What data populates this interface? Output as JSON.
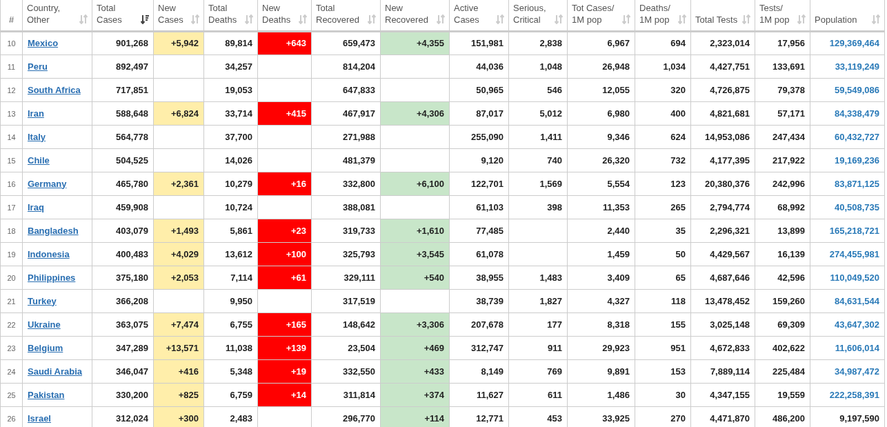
{
  "table": {
    "columns": [
      {
        "label": "#",
        "kind": "index"
      },
      {
        "label": "Country, Other",
        "kind": "country",
        "sorted": false
      },
      {
        "label": "Total Cases",
        "kind": "plain",
        "sorted": true
      },
      {
        "label": "New Cases",
        "kind": "increase",
        "sorted": false
      },
      {
        "label": "Total Deaths",
        "kind": "plain",
        "sorted": false
      },
      {
        "label": "New Deaths",
        "kind": "deaths",
        "sorted": false
      },
      {
        "label": "Total Recovered",
        "kind": "plain",
        "sorted": false
      },
      {
        "label": "New Recovered",
        "kind": "recovered",
        "sorted": false
      },
      {
        "label": "Active Cases",
        "kind": "plain",
        "sorted": false
      },
      {
        "label": "Serious, Critical",
        "kind": "plain",
        "sorted": false
      },
      {
        "label": "Tot Cases/ 1M pop",
        "kind": "plain",
        "sorted": false
      },
      {
        "label": "Deaths/ 1M pop",
        "kind": "plain",
        "sorted": false
      },
      {
        "label": "Total Tests",
        "kind": "plain",
        "sorted": false
      },
      {
        "label": "Tests/ 1M pop",
        "kind": "plain",
        "sorted": false
      },
      {
        "label": "Population",
        "kind": "population",
        "sorted": false
      }
    ],
    "rows": [
      {
        "cells": [
          "10",
          "Mexico",
          "901,268",
          "+5,942",
          "89,814",
          "+643",
          "659,473",
          "+4,355",
          "151,981",
          "2,838",
          "6,967",
          "694",
          "2,323,014",
          "17,956",
          "129,369,464"
        ],
        "population_linked": true
      },
      {
        "cells": [
          "11",
          "Peru",
          "892,497",
          null,
          "34,257",
          null,
          "814,204",
          null,
          "44,036",
          "1,048",
          "26,948",
          "1,034",
          "4,427,751",
          "133,691",
          "33,119,249"
        ],
        "population_linked": true
      },
      {
        "cells": [
          "12",
          "South Africa",
          "717,851",
          null,
          "19,053",
          null,
          "647,833",
          null,
          "50,965",
          "546",
          "12,055",
          "320",
          "4,726,875",
          "79,378",
          "59,549,086"
        ],
        "population_linked": true
      },
      {
        "cells": [
          "13",
          "Iran",
          "588,648",
          "+6,824",
          "33,714",
          "+415",
          "467,917",
          "+4,306",
          "87,017",
          "5,012",
          "6,980",
          "400",
          "4,821,681",
          "57,171",
          "84,338,479"
        ],
        "population_linked": true
      },
      {
        "cells": [
          "14",
          "Italy",
          "564,778",
          null,
          "37,700",
          null,
          "271,988",
          null,
          "255,090",
          "1,411",
          "9,346",
          "624",
          "14,953,086",
          "247,434",
          "60,432,727"
        ],
        "population_linked": true
      },
      {
        "cells": [
          "15",
          "Chile",
          "504,525",
          null,
          "14,026",
          null,
          "481,379",
          null,
          "9,120",
          "740",
          "26,320",
          "732",
          "4,177,395",
          "217,922",
          "19,169,236"
        ],
        "population_linked": true
      },
      {
        "cells": [
          "16",
          "Germany",
          "465,780",
          "+2,361",
          "10,279",
          "+16",
          "332,800",
          "+6,100",
          "122,701",
          "1,569",
          "5,554",
          "123",
          "20,380,376",
          "242,996",
          "83,871,125"
        ],
        "population_linked": true
      },
      {
        "cells": [
          "17",
          "Iraq",
          "459,908",
          null,
          "10,724",
          null,
          "388,081",
          null,
          "61,103",
          "398",
          "11,353",
          "265",
          "2,794,774",
          "68,992",
          "40,508,735"
        ],
        "population_linked": true
      },
      {
        "cells": [
          "18",
          "Bangladesh",
          "403,079",
          "+1,493",
          "5,861",
          "+23",
          "319,733",
          "+1,610",
          "77,485",
          null,
          "2,440",
          "35",
          "2,296,321",
          "13,899",
          "165,218,721"
        ],
        "population_linked": true
      },
      {
        "cells": [
          "19",
          "Indonesia",
          "400,483",
          "+4,029",
          "13,612",
          "+100",
          "325,793",
          "+3,545",
          "61,078",
          null,
          "1,459",
          "50",
          "4,429,567",
          "16,139",
          "274,455,981"
        ],
        "population_linked": true
      },
      {
        "cells": [
          "20",
          "Philippines",
          "375,180",
          "+2,053",
          "7,114",
          "+61",
          "329,111",
          "+540",
          "38,955",
          "1,483",
          "3,409",
          "65",
          "4,687,646",
          "42,596",
          "110,049,520"
        ],
        "population_linked": true
      },
      {
        "cells": [
          "21",
          "Turkey",
          "366,208",
          null,
          "9,950",
          null,
          "317,519",
          null,
          "38,739",
          "1,827",
          "4,327",
          "118",
          "13,478,452",
          "159,260",
          "84,631,544"
        ],
        "population_linked": true
      },
      {
        "cells": [
          "22",
          "Ukraine",
          "363,075",
          "+7,474",
          "6,755",
          "+165",
          "148,642",
          "+3,306",
          "207,678",
          "177",
          "8,318",
          "155",
          "3,025,148",
          "69,309",
          "43,647,302"
        ],
        "population_linked": true
      },
      {
        "cells": [
          "23",
          "Belgium",
          "347,289",
          "+13,571",
          "11,038",
          "+139",
          "23,504",
          "+469",
          "312,747",
          "911",
          "29,923",
          "951",
          "4,672,833",
          "402,622",
          "11,606,014"
        ],
        "population_linked": true
      },
      {
        "cells": [
          "24",
          "Saudi Arabia",
          "346,047",
          "+416",
          "5,348",
          "+19",
          "332,550",
          "+433",
          "8,149",
          "769",
          "9,891",
          "153",
          "7,889,114",
          "225,484",
          "34,987,472"
        ],
        "population_linked": true
      },
      {
        "cells": [
          "25",
          "Pakistan",
          "330,200",
          "+825",
          "6,759",
          "+14",
          "311,814",
          "+374",
          "11,627",
          "611",
          "1,486",
          "30",
          "4,347,155",
          "19,559",
          "222,258,391"
        ],
        "population_linked": true
      },
      {
        "cells": [
          "26",
          "Israel",
          "312,024",
          "+300",
          "2,483",
          null,
          "296,770",
          "+114",
          "12,771",
          "453",
          "33,925",
          "270",
          "4,471,870",
          "486,200",
          "9,197,590"
        ],
        "population_linked": false
      }
    ]
  }
}
